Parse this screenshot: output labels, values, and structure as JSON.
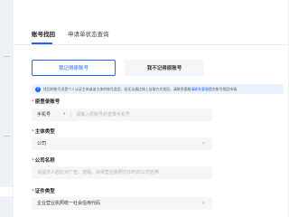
{
  "tabs": [
    {
      "label": "账号找回",
      "active": true
    },
    {
      "label": "申请单状态查询",
      "active": false
    }
  ],
  "options": {
    "remember": "我记得原账号",
    "forgot": "我不记得原账号"
  },
  "notice": {
    "icon": "info-icon",
    "text": "找回的账号须是个人认证主体或该主体的账号类型，若无法通过线上自助方式找回，请联系客服",
    "link": "请联系客服",
    "suffix": "提交账号找回申请"
  },
  "form": {
    "account": {
      "label": "原登录账号",
      "prefix": "手机号",
      "placeholder": "请输入原账号的登录手机号"
    },
    "entity_type": {
      "label": "主体类型",
      "value": "公司"
    },
    "company_name": {
      "label": "公司名称",
      "placeholder": "请提供人脸比对广告、流程、尚待营业执照打印时的公司名称"
    },
    "cert_type": {
      "label": "证件类型",
      "value": "企业营业执照统一社会信用代码"
    }
  },
  "colors": {
    "accent": "#1a66ff",
    "required": "#e53935"
  }
}
